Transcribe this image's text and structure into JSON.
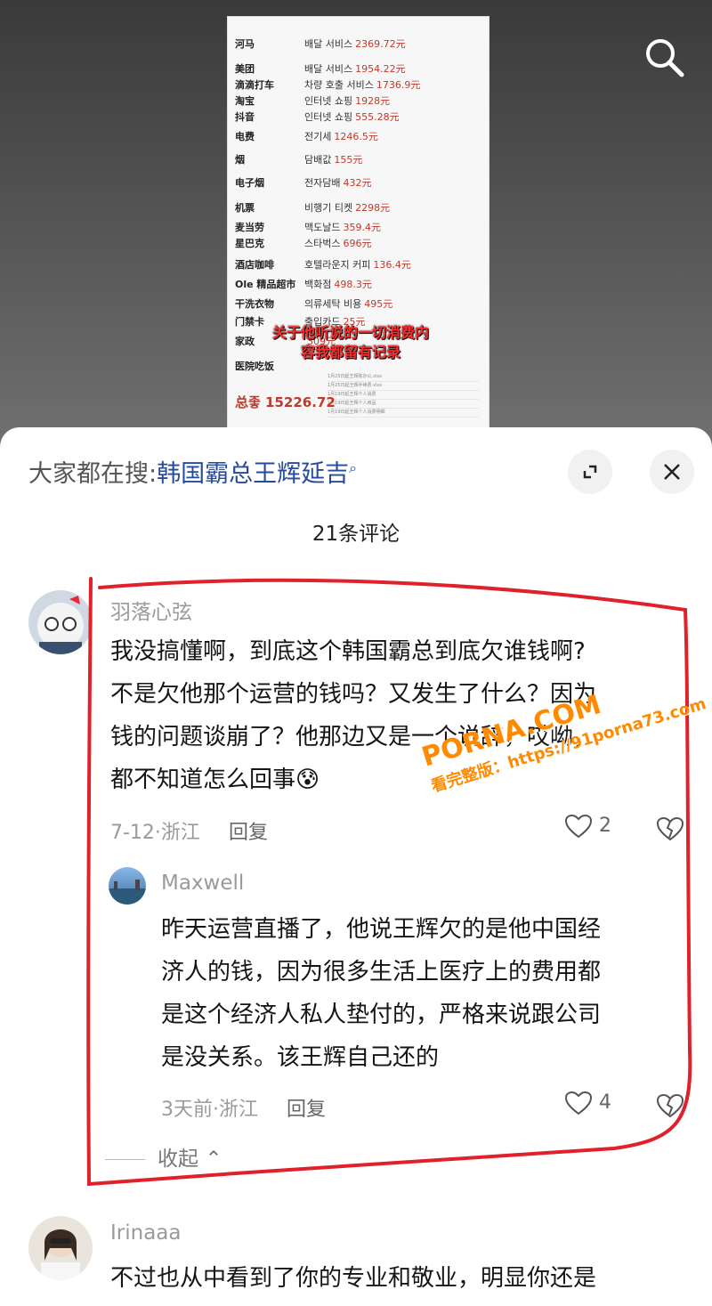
{
  "doc": {
    "rows": [
      {
        "k": "河马",
        "v": "배달 서비스",
        "a": "2369.72元"
      },
      {
        "k": "美团",
        "v": "배달 서비스",
        "a": "1954.22元"
      },
      {
        "k": "滴滴打车",
        "v": "차량 호출 서비스",
        "a": "1736.9元"
      },
      {
        "k": "淘宝",
        "v": "인터넷 쇼핑",
        "a": "1928元"
      },
      {
        "k": "抖音",
        "v": "인터넷 쇼핑",
        "a": "555.28元"
      },
      {
        "k": "电费",
        "v": "전기세",
        "a": "1246.5元"
      },
      {
        "k": "烟",
        "v": "담배값",
        "a": "155元"
      },
      {
        "k": "电子烟",
        "v": "전자담배",
        "a": "432元"
      },
      {
        "k": "机票",
        "v": "비행기 티켓",
        "a": "2298元"
      },
      {
        "k": "麦当劳",
        "v": "맥도날드",
        "a": "359.4元"
      },
      {
        "k": "星巴克",
        "v": "스타벅스",
        "a": "696元"
      },
      {
        "k": "酒店咖啡",
        "v": "호텔라운지 커피",
        "a": "136.4元"
      },
      {
        "k": "Ole 精品超市",
        "v": "백화점",
        "a": "498.3元"
      },
      {
        "k": "干洗衣物",
        "v": "의류세탁 비용",
        "a": "495元"
      },
      {
        "k": "门禁卡",
        "v": "출입카드",
        "a": "25元"
      },
      {
        "k": "家政",
        "v": "",
        "a": "309元"
      },
      {
        "k": "医院吃饭",
        "v": "",
        "a": ""
      }
    ],
    "overlay1": "关于他听说的一切消费内",
    "overlay2": "容我都留有记录",
    "total": "总좋 15226.72",
    "files": [
      "1月25日起王辉陈办公.xlsx",
      "1月25日起王辉手续费.xlsx",
      "1月19日起王辉个人消费",
      "1月19日起王辉个人用品",
      "1月19日起王辉个人消费明细"
    ]
  },
  "sheet": {
    "search_prefix": "大家都在搜:",
    "search_hot": "韩国霸总王辉延吉",
    "count": "21条评论",
    "comments": [
      {
        "user": "羽落心弦",
        "lines": [
          "我没搞懂啊，到底这个韩国霸总到底欠谁钱啊?",
          "不是欠他那个运营的钱吗？又发生了什么？因为",
          "钱的问题谈崩了？他那边又是一个说辞，哎呦，",
          "都不知道怎么回事"
        ],
        "emoji": "😰",
        "meta": "7-12·浙江",
        "reply": "回复",
        "likes": "2"
      },
      {
        "user": "Maxwell",
        "lines": [
          "昨天运营直播了，他说王辉欠的是他中国经",
          "济人的钱，因为很多生活上医疗上的费用都",
          "是这个经济人私人垫付的，严格来说跟公司",
          "是没关系。该王辉自己还的"
        ],
        "meta": "3天前·浙江",
        "reply": "回复",
        "likes": "4"
      },
      {
        "user": "Irinaaa",
        "lines": [
          "不过也从中看到了你的专业和敬业，明显你还是"
        ]
      }
    ],
    "collapse": "收起"
  },
  "watermark": {
    "line1": "PORNA.COM",
    "line2": "看完整版：https://91porna73.com"
  },
  "colors": {
    "accent": "#274b9c",
    "red": "#e0202a",
    "watermark": "#ff8a00"
  }
}
